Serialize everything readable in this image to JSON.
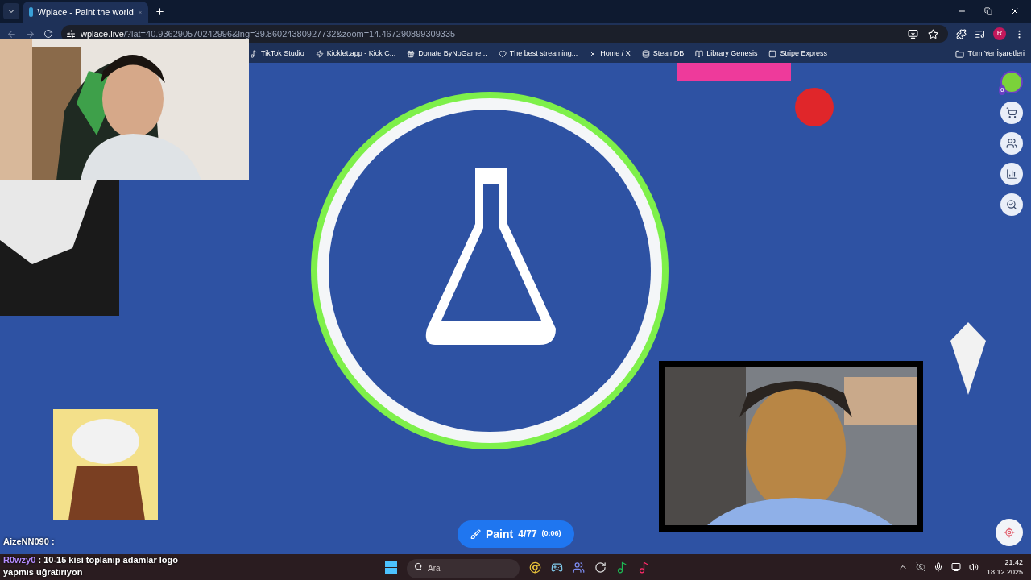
{
  "browser": {
    "tabs": [
      {
        "title": "Wplace - Paint the world",
        "selected": true
      }
    ],
    "url": {
      "host": "wplace.live",
      "path": "/?lat=40.936290570242996&lng=39.86024380927732&zoom=14.467290899309335"
    },
    "profile_initial": "R",
    "bookmarks": [
      {
        "label": "TikTok Studio"
      },
      {
        "label": "Kicklet.app - Kick C..."
      },
      {
        "label": "Donate ByNoGame..."
      },
      {
        "label": "The best streaming..."
      },
      {
        "label": "Home / X"
      },
      {
        "label": "SteamDB"
      },
      {
        "label": "Library Genesis"
      },
      {
        "label": "Stripe Express"
      }
    ],
    "all_bookmarks": "Tüm Yer İşaretleri"
  },
  "map": {
    "user_badge": "6",
    "paint_button": {
      "label": "Paint",
      "count": "4/77",
      "timer": "(0:06)"
    }
  },
  "chat": [
    {
      "user": "AizeNN090",
      "color": "#ffffff",
      "separator": ":"
    },
    {
      "user": "R0wzy0",
      "color": "#b48cff",
      "separator": ":",
      "message": "10-15 kisi toplanıp adamlar logo yapmıs uğratırıyon"
    }
  ],
  "taskbar": {
    "search": {
      "placeholder": "Ara"
    },
    "time": "21:42",
    "date": "18.12.2025"
  }
}
